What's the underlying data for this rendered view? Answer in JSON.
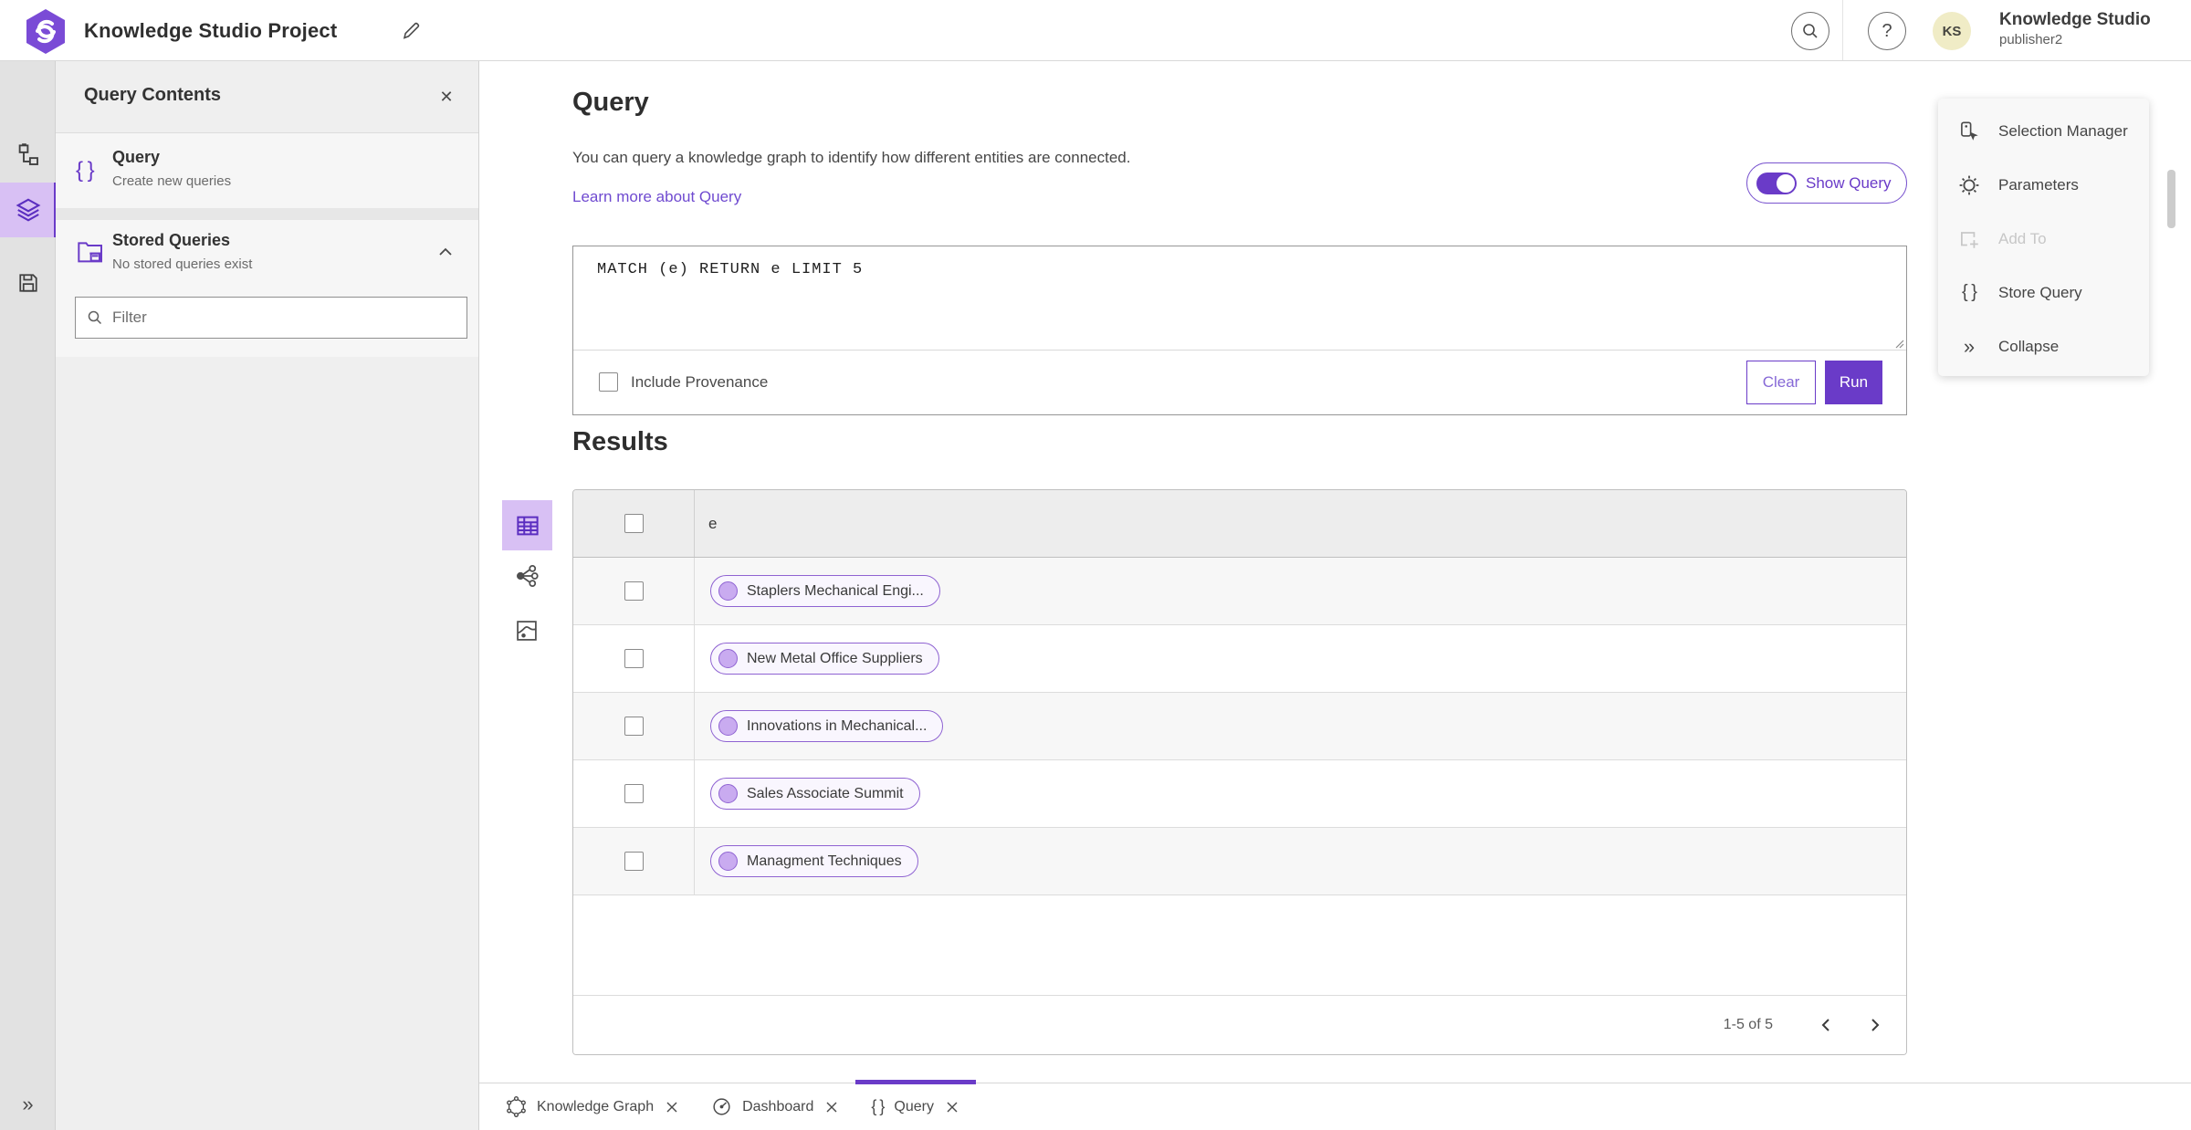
{
  "header": {
    "app_title": "Knowledge Studio Project",
    "user": {
      "initials": "KS",
      "org": "Knowledge Studio",
      "name": "publisher2"
    },
    "help_glyph": "?"
  },
  "icons": {
    "close": "✕",
    "braces": "{ }",
    "collapse": "»"
  },
  "panel": {
    "title": "Query Contents",
    "filter_placeholder": "Filter",
    "items": [
      {
        "title": "Query",
        "subtitle": "Create new queries"
      },
      {
        "title": "Stored Queries",
        "subtitle": "No stored queries exist"
      }
    ]
  },
  "query": {
    "heading": "Query",
    "description": "You can query a knowledge graph to identify how different entities are connected.",
    "link": "Learn more about Query",
    "toggle_label": "Show Query",
    "text": "MATCH (e) RETURN e LIMIT 5",
    "provenance_label": "Include Provenance",
    "clear_label": "Clear",
    "run_label": "Run"
  },
  "results": {
    "heading": "Results",
    "column": "e",
    "rows": [
      "Staplers Mechanical Engi...",
      "New Metal Office Suppliers",
      "Innovations in Mechanical...",
      "Sales Associate Summit",
      "Managment Techniques"
    ],
    "pagination": "1-5 of 5"
  },
  "menu": {
    "items": [
      {
        "label": "Selection Manager"
      },
      {
        "label": "Parameters"
      },
      {
        "label": "Add To",
        "disabled": true
      },
      {
        "label": "Store Query"
      },
      {
        "label": "Collapse"
      }
    ]
  },
  "tabs": [
    {
      "label": "Knowledge Graph"
    },
    {
      "label": "Dashboard"
    },
    {
      "label": "Query",
      "active": true
    }
  ],
  "colors": {
    "accent": "#6a3bc8",
    "accent_light": "#d8c0f4",
    "pill_fill": "#c9abf0"
  }
}
